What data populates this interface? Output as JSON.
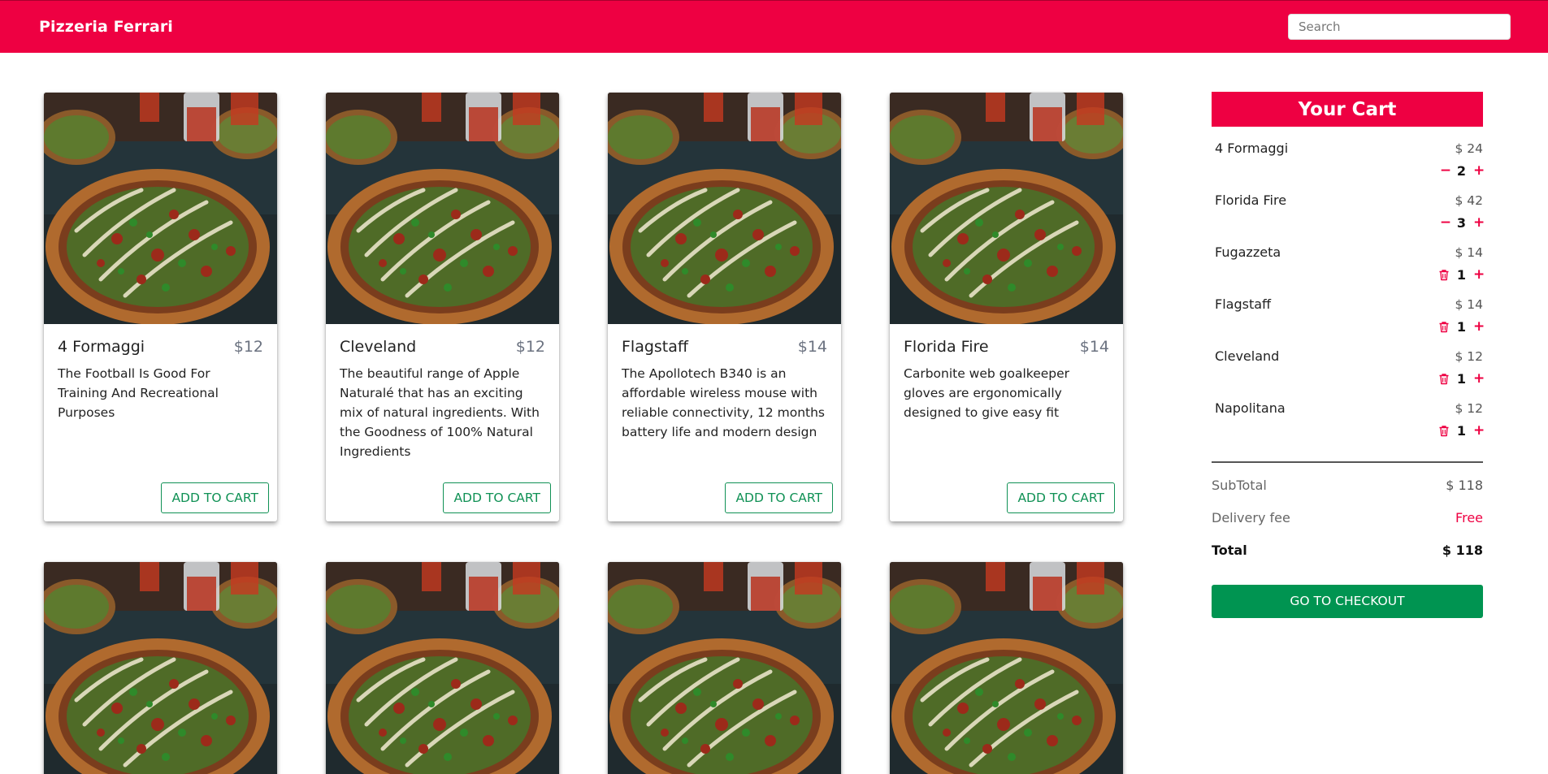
{
  "header": {
    "brand": "Pizzeria Ferrari",
    "search_placeholder": "Search"
  },
  "products": [
    {
      "name": "4 Formaggi",
      "price": "$12",
      "description": "The Football Is Good For Training And Recreational Purposes",
      "button": "ADD TO CART"
    },
    {
      "name": "Cleveland",
      "price": "$12",
      "description": "The beautiful range of Apple Naturalé that has an exciting mix of natural ingredients. With the Goodness of 100% Natural Ingredients",
      "button": "ADD TO CART"
    },
    {
      "name": "Flagstaff",
      "price": "$14",
      "description": "The Apollotech B340 is an affordable wireless mouse with reliable connectivity, 12 months battery life and modern design",
      "button": "ADD TO CART"
    },
    {
      "name": "Florida Fire",
      "price": "$14",
      "description": "Carbonite web goalkeeper gloves are ergonomically designed to give easy fit",
      "button": "ADD TO CART"
    }
  ],
  "cart": {
    "title": "Your Cart",
    "items": [
      {
        "name": "4 Formaggi",
        "price": "$ 24",
        "qty": "2",
        "dec_icon": "minus",
        "dec_symbol": "−",
        "inc_symbol": "+"
      },
      {
        "name": "Florida Fire",
        "price": "$ 42",
        "qty": "3",
        "dec_icon": "minus",
        "dec_symbol": "−",
        "inc_symbol": "+"
      },
      {
        "name": "Fugazzeta",
        "price": "$ 14",
        "qty": "1",
        "dec_icon": "trash",
        "inc_symbol": "+"
      },
      {
        "name": "Flagstaff",
        "price": "$ 14",
        "qty": "1",
        "dec_icon": "trash",
        "inc_symbol": "+"
      },
      {
        "name": "Cleveland",
        "price": "$ 12",
        "qty": "1",
        "dec_icon": "trash",
        "inc_symbol": "+"
      },
      {
        "name": "Napolitana",
        "price": "$ 12",
        "qty": "1",
        "dec_icon": "trash",
        "inc_symbol": "+"
      }
    ],
    "subtotal_label": "SubTotal",
    "subtotal": "$ 118",
    "delivery_label": "Delivery fee",
    "delivery": "Free",
    "total_label": "Total",
    "total": "$ 118",
    "checkout": "GO TO CHECKOUT"
  },
  "colors": {
    "brand": "#ee0042",
    "accent_green": "#009451"
  }
}
